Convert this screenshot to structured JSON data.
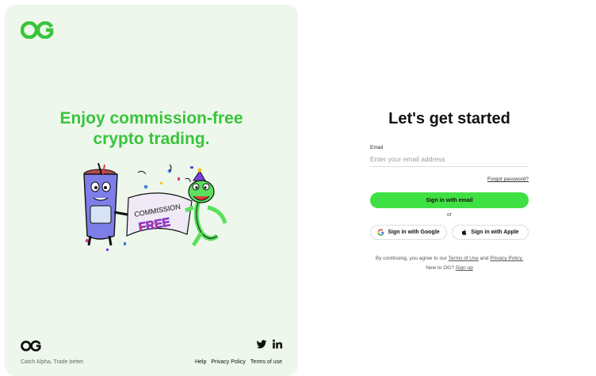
{
  "brand": {
    "logo_text": "OG",
    "accent": "#3fe043",
    "headline_color": "#39c43b",
    "panel_bg": "#eef7ec"
  },
  "hero": {
    "headline_line1": "Enjoy commission-free",
    "headline_line2": "crypto trading.",
    "banner_line1": "COMMISSION",
    "banner_line2": "FREE"
  },
  "left_footer": {
    "tagline": "Catch Alpha, Trade better.",
    "social_icons": [
      "twitter-icon",
      "linkedin-icon"
    ],
    "links": {
      "help": "Help",
      "privacy": "Privacy Policy",
      "terms": "Terms of use"
    }
  },
  "signin": {
    "title": "Let's get started",
    "email_label": "Email",
    "email_placeholder": "Enter your email address",
    "forgot": "Forgot password?",
    "primary_button": "Sign in with email",
    "or": "or",
    "google_button": "Sign in with Google",
    "apple_button": "Sign in with Apple",
    "legal_prefix": "By continuing, you agree to our",
    "terms_link": "Terms of Use",
    "legal_and": "and",
    "privacy_link": "Privacy Policy.",
    "new_prefix": "New to OG?",
    "signup_link": "Sign up"
  }
}
